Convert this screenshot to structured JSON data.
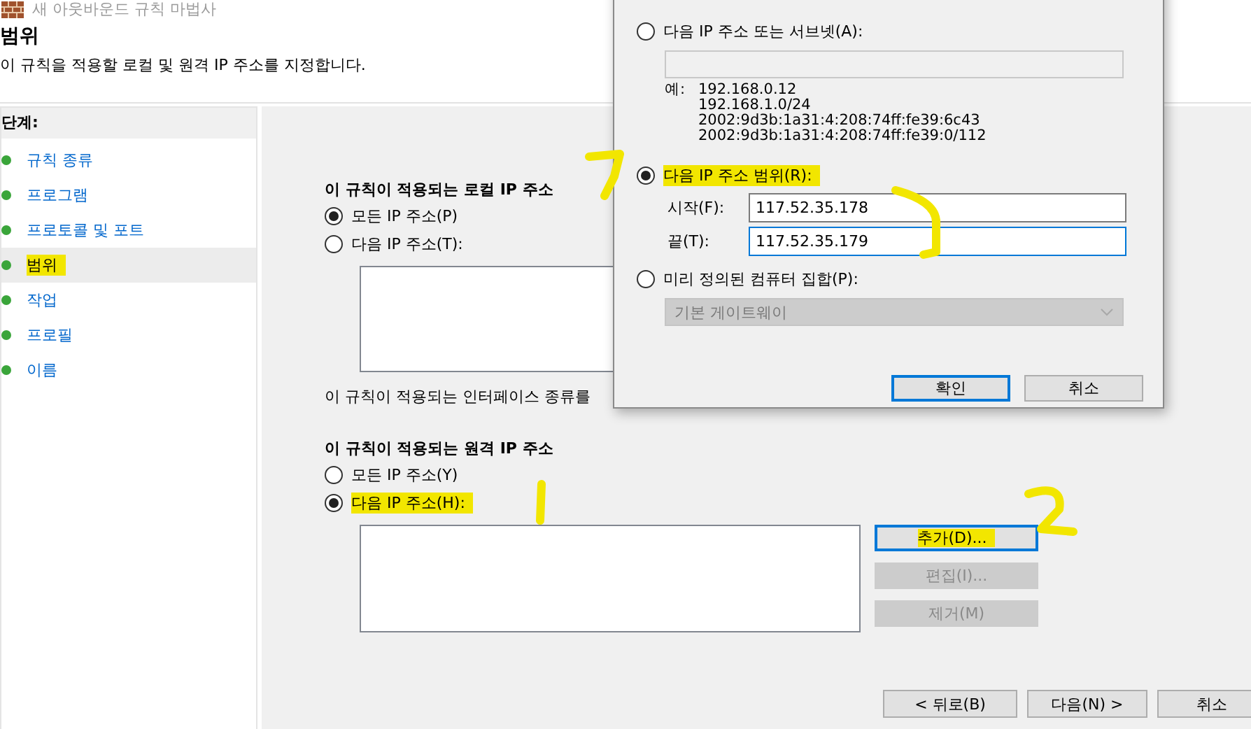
{
  "window": {
    "title": "새 아웃바운드 규칙 마법사"
  },
  "page": {
    "heading": "범위",
    "description": "이 규칙을 적용할 로컬 및 원격 IP 주소를 지정합니다."
  },
  "steps": {
    "header": "단계:",
    "items": [
      {
        "label": "규칙 종류",
        "selected": false,
        "highlighted": false
      },
      {
        "label": "프로그램",
        "selected": false,
        "highlighted": false
      },
      {
        "label": "프로토콜 및 포트",
        "selected": false,
        "highlighted": false
      },
      {
        "label": "범위",
        "selected": true,
        "highlighted": true
      },
      {
        "label": "작업",
        "selected": false,
        "highlighted": false
      },
      {
        "label": "프로필",
        "selected": false,
        "highlighted": false
      },
      {
        "label": "이름",
        "selected": false,
        "highlighted": false
      }
    ]
  },
  "local_ip": {
    "label": "이 규칙이 적용되는 로컬 IP 주소",
    "options": [
      {
        "label": "모든 IP 주소(P)",
        "selected": true,
        "highlighted": false
      },
      {
        "label": "다음 IP 주소(T):",
        "selected": false,
        "highlighted": false
      }
    ]
  },
  "interface_text": "이 규칙이 적용되는 인터페이스 종류를",
  "remote_ip": {
    "label": "이 규칙이 적용되는 원격 IP 주소",
    "options": [
      {
        "label": "모든 IP 주소(Y)",
        "selected": false,
        "highlighted": false
      },
      {
        "label": "다음 IP 주소(H):",
        "selected": true,
        "highlighted": true
      }
    ],
    "buttons": [
      {
        "label": "추가(D)...",
        "disabled": false,
        "focused": true,
        "highlighted": true
      },
      {
        "label": "편집(I)...",
        "disabled": true,
        "focused": false,
        "highlighted": false
      },
      {
        "label": "제거(M)",
        "disabled": true,
        "focused": false,
        "highlighted": false
      }
    ]
  },
  "nav_buttons": [
    "< 뒤로(B)",
    "다음(N) >",
    "취소"
  ],
  "dialog": {
    "subnet_option": {
      "label": "다음 IP 주소 또는 서브넷(A):",
      "selected": false,
      "highlighted": false
    },
    "examples_label": "예:",
    "examples": [
      "192.168.0.12",
      "192.168.1.0/24",
      "2002:9d3b:1a31:4:208:74ff:fe39:6c43",
      "2002:9d3b:1a31:4:208:74ff:fe39:0/112"
    ],
    "range_option": {
      "label": "다음 IP 주소 범위(R):",
      "selected": true,
      "highlighted": true
    },
    "range_fields": [
      {
        "label": "시작(F):",
        "value": "117.52.35.178",
        "focused": false
      },
      {
        "label": "끝(T):",
        "value": "117.52.35.179",
        "focused": true
      }
    ],
    "predefined_option": {
      "label": "미리 정의된 컴퓨터 집합(P):",
      "selected": false,
      "highlighted": false
    },
    "predefined_value": "기본 게이트웨이",
    "buttons": [
      {
        "label": "확인",
        "focused": true
      },
      {
        "label": "취소",
        "focused": false
      }
    ]
  }
}
